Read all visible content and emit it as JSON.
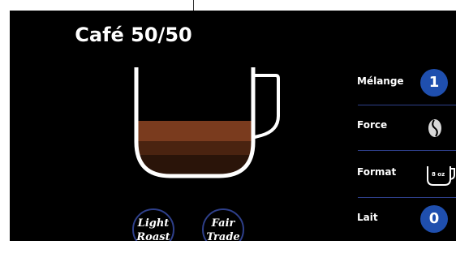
{
  "title": "Café 50/50",
  "badges": [
    {
      "line1": "Light",
      "line2": "Roast"
    },
    {
      "line1": "Fair",
      "line2": "Trade"
    }
  ],
  "options": {
    "melange": {
      "label": "Mélange",
      "value": "1"
    },
    "force": {
      "label": "Force",
      "icon": "coffee-bean-icon"
    },
    "format": {
      "label": "Format",
      "icon": "cup-size-icon",
      "size_text": "8 oz"
    },
    "lait": {
      "label": "Lait",
      "value": "0"
    }
  },
  "colors": {
    "background": "#000000",
    "accent": "#1f4fae",
    "divider": "#2e3f8a",
    "coffee_top": "#7a3b1e",
    "coffee_mid": "#4a2310",
    "coffee_bottom": "#2a1409"
  }
}
